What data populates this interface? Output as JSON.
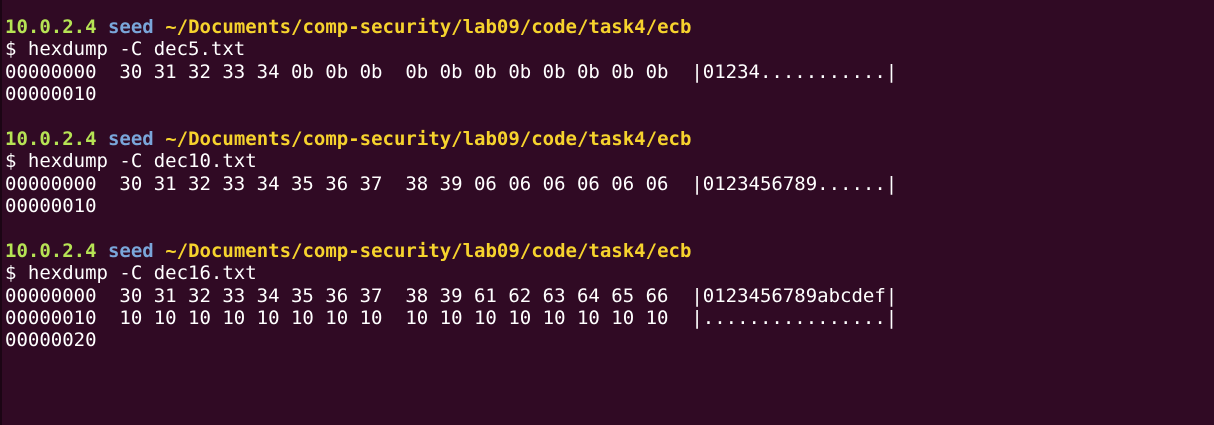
{
  "colors": {
    "background": "#300a24",
    "host": "#b6e354",
    "user": "#7aa6da",
    "path": "#f6d32d",
    "text": "#ffffff"
  },
  "blocks": [
    {
      "prompt": {
        "host": "10.0.2.4",
        "user": "seed",
        "path": "~/Documents/comp-security/lab09/code/task4/ecb"
      },
      "command": "$ hexdump -C dec5.txt",
      "output": [
        "00000000  30 31 32 33 34 0b 0b 0b  0b 0b 0b 0b 0b 0b 0b 0b  |01234...........|",
        "00000010"
      ]
    },
    {
      "prompt": {
        "host": "10.0.2.4",
        "user": "seed",
        "path": "~/Documents/comp-security/lab09/code/task4/ecb"
      },
      "command": "$ hexdump -C dec10.txt",
      "output": [
        "00000000  30 31 32 33 34 35 36 37  38 39 06 06 06 06 06 06  |0123456789......|",
        "00000010"
      ]
    },
    {
      "prompt": {
        "host": "10.0.2.4",
        "user": "seed",
        "path": "~/Documents/comp-security/lab09/code/task4/ecb"
      },
      "command": "$ hexdump -C dec16.txt",
      "output": [
        "00000000  30 31 32 33 34 35 36 37  38 39 61 62 63 64 65 66  |0123456789abcdef|",
        "00000010  10 10 10 10 10 10 10 10  10 10 10 10 10 10 10 10  |................|",
        "00000020"
      ]
    }
  ]
}
